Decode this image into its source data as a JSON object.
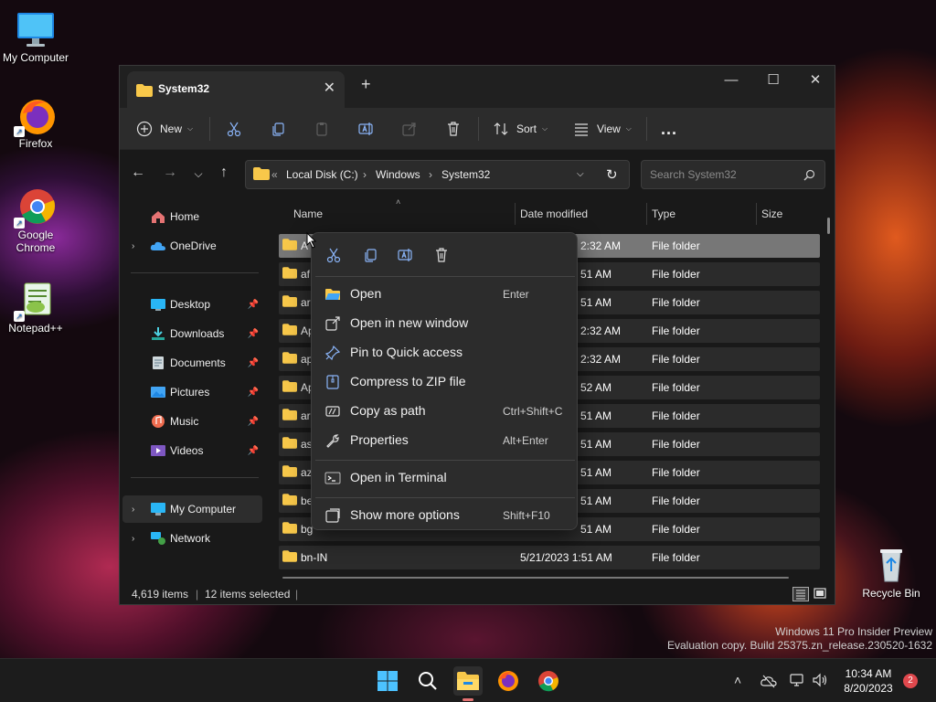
{
  "desktop": {
    "icons": [
      {
        "label": "My Computer"
      },
      {
        "label": "Firefox"
      },
      {
        "label": "Google Chrome"
      },
      {
        "label": "Notepad++"
      }
    ],
    "recycle_bin": "Recycle Bin"
  },
  "window": {
    "tab_title": "System32",
    "toolbar": {
      "new_label": "New",
      "sort_label": "Sort",
      "view_label": "View",
      "more": "..."
    },
    "address": {
      "prefix": "«",
      "crumbs": [
        "Local Disk (C:)",
        "Windows",
        "System32"
      ]
    },
    "search_placeholder": "Search System32",
    "sidebar": {
      "home": "Home",
      "onedrive": "OneDrive",
      "quick": [
        "Desktop",
        "Downloads",
        "Documents",
        "Pictures",
        "Music",
        "Videos"
      ],
      "my_computer": "My Computer",
      "network": "Network"
    },
    "columns": {
      "name": "Name",
      "date": "Date modified",
      "type": "Type",
      "size": "Size"
    },
    "rows": [
      {
        "name": "A",
        "date": "2:32 AM",
        "type": "File folder"
      },
      {
        "name": "af",
        "date": "51 AM",
        "type": "File folder"
      },
      {
        "name": "ar",
        "date": "51 AM",
        "type": "File folder"
      },
      {
        "name": "Ap",
        "date": "2:32 AM",
        "type": "File folder"
      },
      {
        "name": "ap",
        "date": "2:32 AM",
        "type": "File folder"
      },
      {
        "name": "Ap",
        "date": "52 AM",
        "type": "File folder"
      },
      {
        "name": "ar",
        "date": "51 AM",
        "type": "File folder"
      },
      {
        "name": "as",
        "date": "51 AM",
        "type": "File folder"
      },
      {
        "name": "az",
        "date": "51 AM",
        "type": "File folder"
      },
      {
        "name": "be",
        "date": "51 AM",
        "type": "File folder"
      },
      {
        "name": "bg",
        "date": "51 AM",
        "type": "File folder"
      },
      {
        "name": "bn-IN",
        "date": "5/21/2023 1:51 AM",
        "type": "File folder"
      }
    ],
    "status": {
      "items": "4,619 items",
      "selected": "12 items selected"
    }
  },
  "context_menu": {
    "items": [
      {
        "label": "Open",
        "shortcut": "Enter"
      },
      {
        "label": "Open in new window",
        "shortcut": ""
      },
      {
        "label": "Pin to Quick access",
        "shortcut": ""
      },
      {
        "label": "Compress to ZIP file",
        "shortcut": ""
      },
      {
        "label": "Copy as path",
        "shortcut": "Ctrl+Shift+C"
      },
      {
        "label": "Properties",
        "shortcut": "Alt+Enter"
      },
      {
        "label": "Open in Terminal",
        "shortcut": ""
      },
      {
        "label": "Show more options",
        "shortcut": "Shift+F10"
      }
    ]
  },
  "watermark": {
    "line1": "Windows 11 Pro Insider Preview",
    "line2": "Evaluation copy. Build 25375.zn_release.230520-1632"
  },
  "taskbar": {
    "time": "10:34 AM",
    "date": "8/20/2023",
    "notifications": "2"
  },
  "colors": {
    "accent": "#0078d4",
    "folder": "#f8c84a",
    "window_bg": "#191919"
  }
}
